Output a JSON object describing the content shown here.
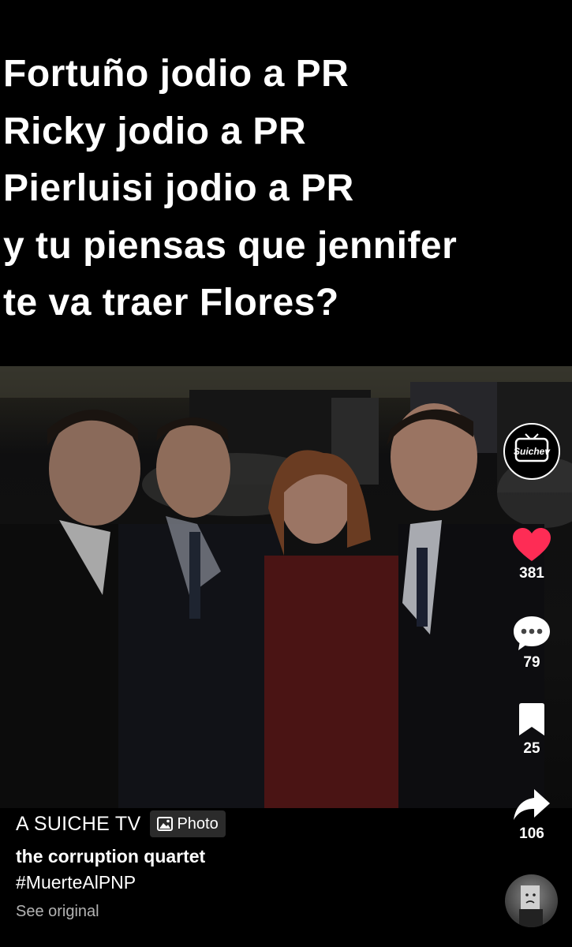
{
  "headline": {
    "lines": [
      "Fortuño jodio a PR",
      "Ricky jodio a PR",
      "Pierluisi jodio a PR",
      "y tu piensas que jennifer",
      "te va traer Flores?"
    ]
  },
  "channel_logo": {
    "text": "Suichev",
    "icon": "tv-logo-icon"
  },
  "actions": {
    "likes": "381",
    "comments": "79",
    "saves": "25",
    "shares": "106"
  },
  "post": {
    "author": "A SUICHE TV",
    "badge_label": "Photo",
    "caption": "the corruption quartet",
    "hashtag": "#MuerteAlPNP",
    "see_original": "See original"
  },
  "colors": {
    "background": "#000000",
    "like_red": "#fe2c55",
    "text": "#ffffff",
    "muted": "#b3b3b3"
  }
}
